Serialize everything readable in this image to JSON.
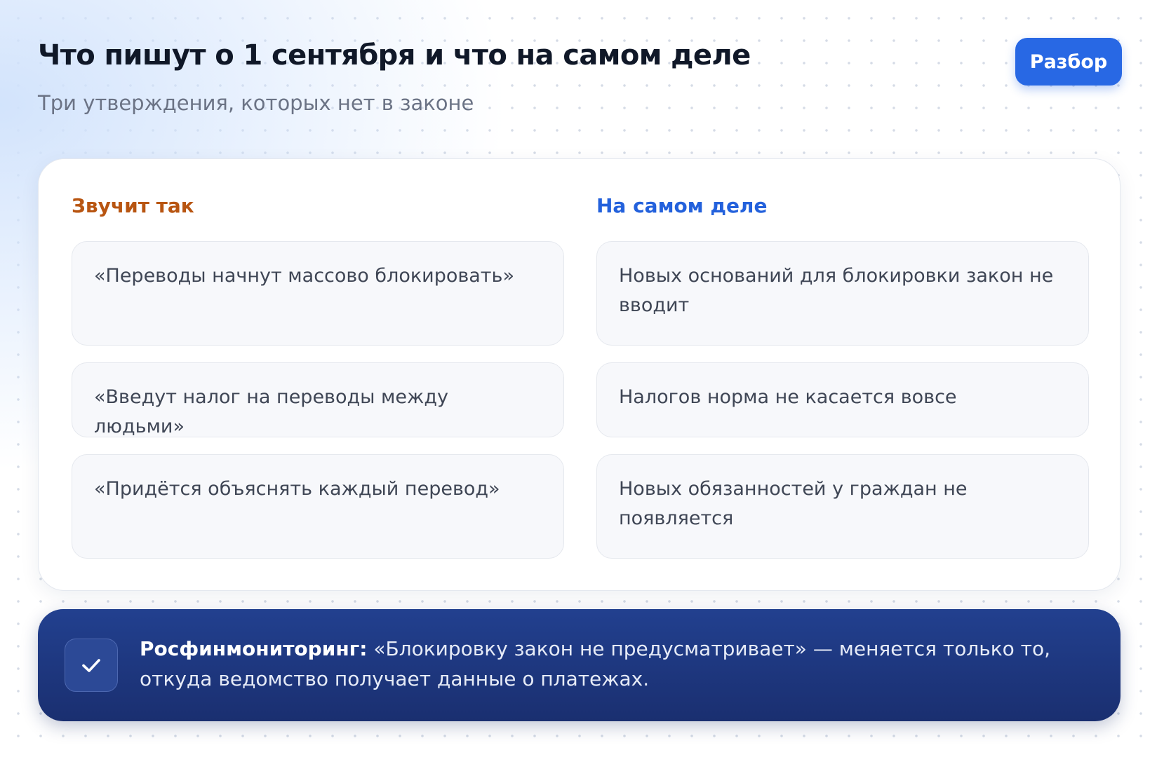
{
  "header": {
    "title": "Что пишут о 1 сентября и что на самом деле",
    "subtitle": "Три утверждения, которых нет в законе",
    "action_label": "Разбор"
  },
  "comparison": {
    "myth_heading": "Звучит так",
    "fact_heading": "На самом деле",
    "rows": [
      {
        "myth": "«Переводы начнут массово блокировать»",
        "fact": "Новых оснований для блокировки закон не вводит"
      },
      {
        "myth": "«Введут налог на переводы между людьми»",
        "fact": "Налогов норма не касается вовсе"
      },
      {
        "myth": "«Придётся объяснять каждый перевод»",
        "fact": "Новых обязанностей у граждан не появляется"
      }
    ]
  },
  "note": {
    "icon": "check-icon",
    "source": "Росфинмониторинг:",
    "text": "«Блокировку закон не предусматривает» — меняется только то, откуда ведомство получает данные о платежах."
  },
  "colors": {
    "accent": "#2868e4",
    "myth_heading": "#b85511",
    "fact_heading": "#2361dc",
    "banner": "#1f3a85"
  }
}
